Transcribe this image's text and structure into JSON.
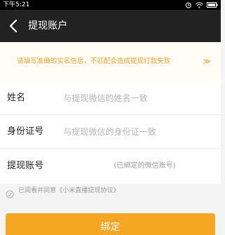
{
  "status_bar": {
    "time": "下午5:21",
    "icons": [
      "alarm-icon",
      "wifi-icon",
      "battery-icon"
    ]
  },
  "nav": {
    "title": "提现账户",
    "back_icon": "chevron-left-icon"
  },
  "notice": {
    "text": "请填写准确的实名信息，不匹配会造成提现打款失败",
    "arrow": "≫"
  },
  "form": {
    "name": {
      "label": "姓名",
      "placeholder": "与提现微信的姓名一致"
    },
    "id_number": {
      "label": "身份证号",
      "placeholder": "与提现微信的身份证一致"
    },
    "account": {
      "label": "提现账号",
      "value": "",
      "hint": "(已绑定的微信账号)"
    }
  },
  "agreement": {
    "text": "已阅看并同意《小米直播提现协议》",
    "checked": true
  },
  "submit": {
    "label": "绑定"
  },
  "colors": {
    "accent": "#f5a623",
    "notice_text": "#f1a128",
    "nav_bg": "#222222"
  }
}
